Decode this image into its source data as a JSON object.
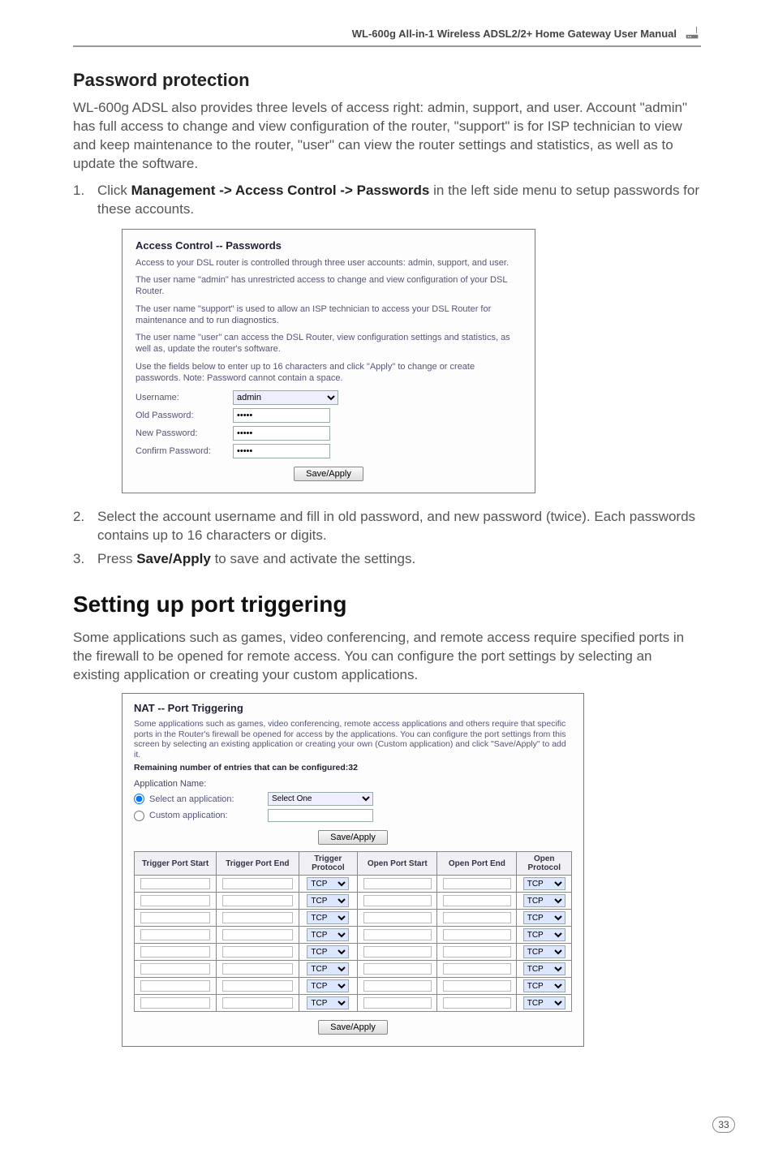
{
  "header": {
    "manual_title": "WL-600g All-in-1 Wireless ADSL2/2+ Home Gateway User Manual"
  },
  "section_password": {
    "heading": "Password protection",
    "intro": "WL-600g ADSL also provides three levels of access right: admin, support, and user. Account \"admin\" has full access to change and view configuration of the router, \"support\" is for ISP technician to view and keep maintenance to the router, \"user\" can view the router settings and statistics, as well as to update the software.",
    "step1_num": "1.",
    "step1_pre": "Click ",
    "step1_bold": "Management -> Access Control -> Passwords",
    "step1_post": " in the left side menu to setup passwords for these accounts.",
    "step2_num": "2.",
    "step2_text": "Select the account username and fill in old password, and new password (twice). Each passwords contains up to 16 characters or digits.",
    "step3_num": "3.",
    "step3_pre": "Press ",
    "step3_bold": "Save/Apply",
    "step3_post": " to save and activate the settings."
  },
  "ss_password": {
    "title": "Access Control -- Passwords",
    "p1": "Access to your DSL router is controlled through three user accounts: admin, support, and user.",
    "p2": "The user name \"admin\" has unrestricted access to change and view configuration of your DSL Router.",
    "p3": "The user name \"support\" is used to allow an ISP technician to access your DSL Router for maintenance and to run diagnostics.",
    "p4": "The user name \"user\" can access the DSL Router, view configuration settings and statistics, as well as, update the router's software.",
    "p5": "Use the fields below to enter up to 16 characters and click \"Apply\" to change or create passwords. Note: Password cannot contain a space.",
    "row_username": "Username:",
    "username_value": "admin",
    "row_old": "Old Password:",
    "row_new": "New Password:",
    "row_confirm": "Confirm Password:",
    "masked": "•••••",
    "btn": "Save/Apply"
  },
  "section_trigger": {
    "heading": "Setting up port triggering",
    "intro": "Some applications such as games, video conferencing, and remote access require specified ports in the firewall to be opened for remote access. You can configure the port settings by selecting an existing application or creating your custom applications."
  },
  "ss_trigger": {
    "title": "NAT -- Port Triggering",
    "blurb": "Some applications such as games, video conferencing, remote access applications and others require that specific ports in the Router's firewall be opened for access by the applications. You can configure the port settings from this screen by selecting an existing application or creating your own (Custom application) and click \"Save/Apply\" to add it.",
    "remaining": "Remaining number of entries that can be configured:32",
    "appname_label": "Application Name:",
    "radio_select": "Select an application:",
    "select_value": "Select One",
    "radio_custom": "Custom application:",
    "btn_top": "Save/Apply",
    "btn_bottom": "Save/Apply",
    "th": [
      "Trigger Port Start",
      "Trigger Port End",
      "Trigger Protocol",
      "Open Port Start",
      "Open Port End",
      "Open Protocol"
    ],
    "proto_default": "TCP",
    "rows": 8
  },
  "page_number": "33"
}
